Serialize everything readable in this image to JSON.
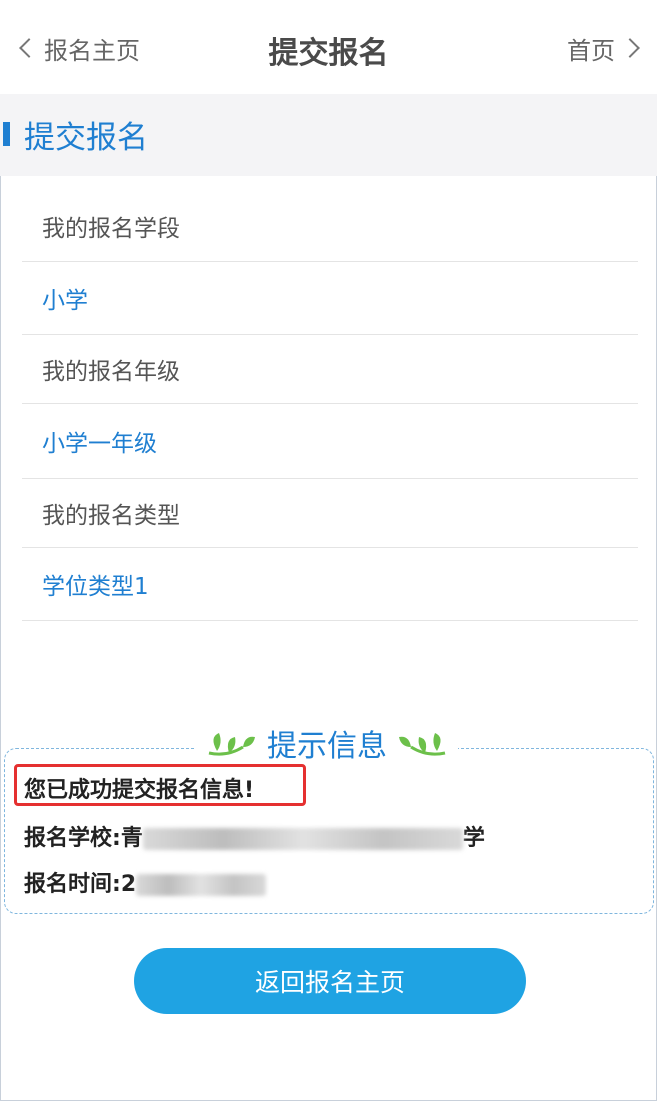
{
  "header": {
    "back_label": "报名主页",
    "title": "提交报名",
    "home_label": "首页"
  },
  "section": {
    "title": "提交报名"
  },
  "fields": [
    {
      "label": "我的报名学段",
      "value": "小学"
    },
    {
      "label": "我的报名年级",
      "value": "小学一年级"
    },
    {
      "label": "我的报名类型",
      "value": "学位类型1"
    }
  ],
  "tip": {
    "title": "提示信息",
    "success_message": "您已成功提交报名信息!",
    "school_label": "报名学校:",
    "school_value_visible_start": "青",
    "school_value_visible_end": "学",
    "time_label": "报名时间:",
    "time_value_visible_start": "2"
  },
  "return_button_label": "返回报名主页",
  "colors": {
    "accent_blue": "#1f7fd1",
    "button_blue": "#1fa3e3",
    "highlight_red": "#e53030",
    "leaf_green": "#6cc04a"
  }
}
